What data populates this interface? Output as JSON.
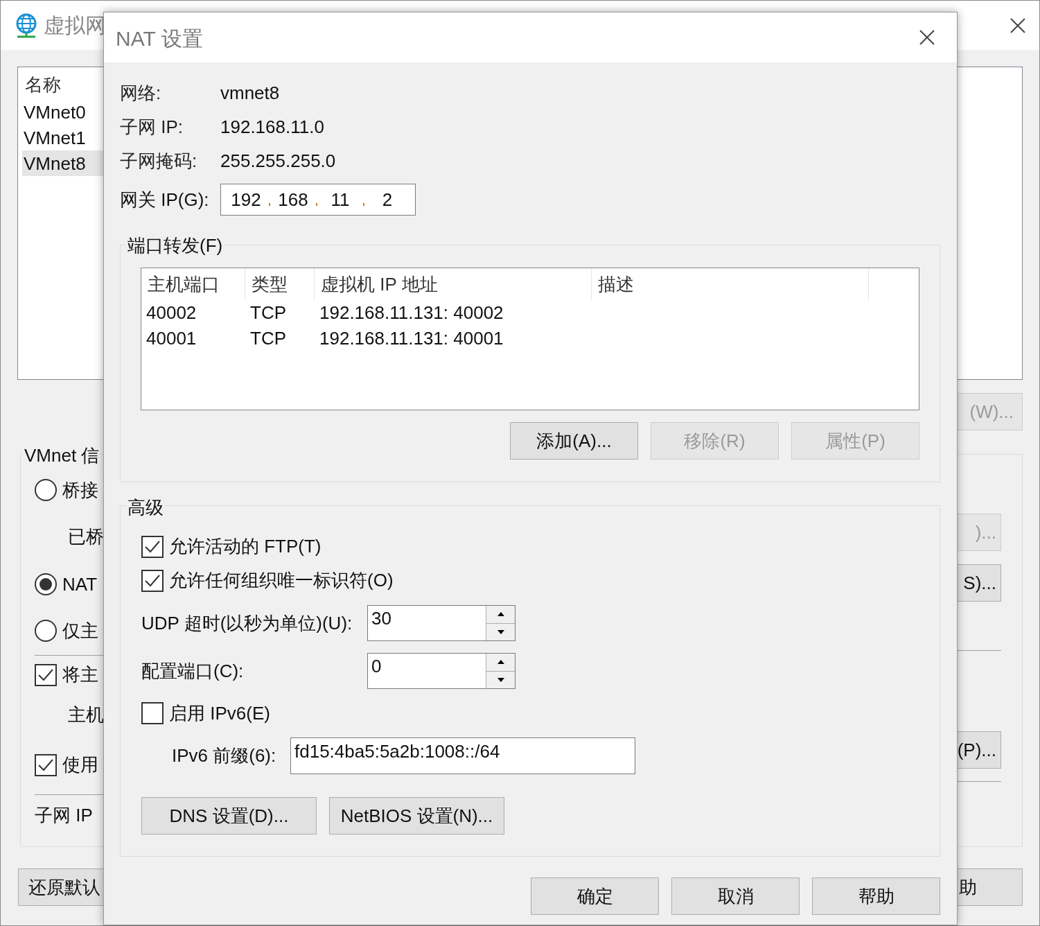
{
  "background_window": {
    "title": "虚拟网",
    "list": {
      "header": "名称",
      "items": [
        {
          "label": "VMnet0",
          "selected": false
        },
        {
          "label": "VMnet1",
          "selected": false
        },
        {
          "label": "VMnet8",
          "selected": true
        }
      ]
    },
    "list_button": {
      "label": "(W)...",
      "disabled": true
    },
    "group_title": "VMnet 信",
    "options": [
      {
        "kind": "radio",
        "label": "桥接",
        "selected": false
      },
      {
        "kind": "text",
        "label": "已桥"
      },
      {
        "kind": "radio",
        "label": "NAT",
        "selected": true
      },
      {
        "kind": "radio",
        "label": "仅主",
        "selected": false
      },
      {
        "kind": "checkbox",
        "label": "将主",
        "checked": true
      },
      {
        "kind": "text",
        "label": "主机"
      },
      {
        "kind": "checkbox",
        "label": "使用",
        "checked": true
      },
      {
        "kind": "text",
        "label": "子网 IP"
      }
    ],
    "side_buttons": [
      {
        "label": ")...",
        "disabled": true
      },
      {
        "label": "S)...",
        "disabled": false
      },
      {
        "label": "(P)...",
        "disabled": false
      }
    ],
    "footer_buttons": [
      {
        "label": "还原默认"
      },
      {
        "label": "助"
      }
    ]
  },
  "dialog": {
    "title": "NAT 设置",
    "info": [
      {
        "label": "网络:",
        "value": "vmnet8"
      },
      {
        "label": "子网 IP:",
        "value": "192.168.11.0"
      },
      {
        "label": "子网掩码:",
        "value": "255.255.255.0"
      }
    ],
    "gateway": {
      "label": "网关 IP(G):",
      "octets": [
        "192",
        "168",
        "11",
        "2"
      ]
    },
    "port_forwarding": {
      "title": "端口转发(F)",
      "columns": [
        "主机端口",
        "类型",
        "虚拟机 IP 地址",
        "描述"
      ],
      "rows": [
        [
          "40002",
          "TCP",
          "192.168.11.131: 40002"
        ],
        [
          "40001",
          "TCP",
          "192.168.11.131: 40001"
        ]
      ],
      "buttons": [
        {
          "label": "添加(A)...",
          "disabled": false
        },
        {
          "label": "移除(R)",
          "disabled": true
        },
        {
          "label": "属性(P)",
          "disabled": true
        }
      ]
    },
    "advanced": {
      "title": "高级",
      "ftp": {
        "label": "允许活动的 FTP(T)",
        "checked": true
      },
      "oui": {
        "label": "允许任何组织唯一标识符(O)",
        "checked": true
      },
      "udp_timeout": {
        "label": "UDP 超时(以秒为单位)(U):",
        "value": "30"
      },
      "config_port": {
        "label": "配置端口(C):",
        "value": "0"
      },
      "ipv6": {
        "label": "启用 IPv6(E)",
        "checked": false
      },
      "ipv6_prefix": {
        "label": "IPv6 前缀(6):",
        "value": "fd15:4ba5:5a2b:1008::/64"
      },
      "buttons": [
        {
          "label": "DNS 设置(D)..."
        },
        {
          "label": "NetBIOS 设置(N)..."
        }
      ]
    },
    "buttons": [
      {
        "label": "确定"
      },
      {
        "label": "取消"
      },
      {
        "label": "帮助"
      }
    ]
  }
}
